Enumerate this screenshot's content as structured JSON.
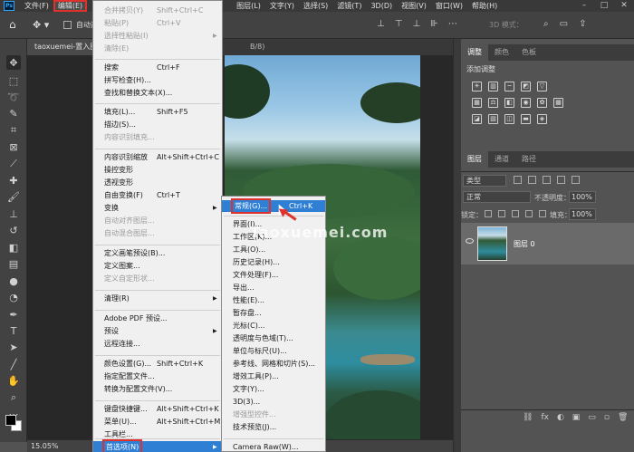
{
  "menubar": {
    "logo": "Ps",
    "items": [
      "文件(F)",
      "编辑(E)",
      "图像(I)",
      "图层(L)",
      "文字(Y)",
      "选择(S)",
      "滤镜(T)",
      "3D(D)",
      "视图(V)",
      "窗口(W)",
      "帮助(H)"
    ],
    "window_controls": [
      "–",
      "□",
      "✕"
    ]
  },
  "options": {
    "auto_select_label": "自动选择",
    "mode_3d": "3D 模式："
  },
  "document": {
    "tab_label": "taoxuemei-置入图",
    "tab_tail": "B/8)",
    "zoom": "15.05%",
    "watermark": "Taoxuemei.com"
  },
  "right_panel": {
    "top_tabs": [
      "调整",
      "颜色",
      "色板"
    ],
    "add_adjustment": "添加调整",
    "layer_tabs": [
      "图层",
      "通道",
      "路径"
    ],
    "filter_kind": "类型",
    "blend_mode": "正常",
    "opacity_label": "不透明度：",
    "opacity_value": "100%",
    "lock_label": "锁定：",
    "fill_label": "填充：",
    "fill_value": "100%",
    "layer_name": "图层 0",
    "footer_icons": [
      "fx",
      "◐",
      "▣",
      "▭",
      "▫",
      "🗑"
    ]
  },
  "edit_menu": {
    "items": [
      {
        "label": "合并拷贝(Y)",
        "shortcut": "Shift+Ctrl+C",
        "disabled": true
      },
      {
        "label": "粘贴(P)",
        "shortcut": "Ctrl+V",
        "disabled": true
      },
      {
        "label": "选择性粘贴(I)",
        "shortcut": "",
        "disabled": true,
        "submenu": true
      },
      {
        "label": "清除(E)",
        "shortcut": "",
        "disabled": true
      },
      {
        "label": "搜索",
        "shortcut": "Ctrl+F"
      },
      {
        "label": "拼写检查(H)...",
        "shortcut": ""
      },
      {
        "label": "查找和替换文本(X)...",
        "shortcut": ""
      },
      {
        "label": "填充(L)...",
        "shortcut": "Shift+F5"
      },
      {
        "label": "描边(S)...",
        "shortcut": ""
      },
      {
        "label": "内容识别填充...",
        "shortcut": "",
        "disabled": true
      },
      {
        "label": "内容识别缩放",
        "shortcut": "Alt+Shift+Ctrl+C"
      },
      {
        "label": "操控变形",
        "shortcut": ""
      },
      {
        "label": "透视变形",
        "shortcut": ""
      },
      {
        "label": "自由变换(F)",
        "shortcut": "Ctrl+T"
      },
      {
        "label": "变换",
        "shortcut": "",
        "submenu": true
      },
      {
        "label": "自动对齐图层...",
        "shortcut": "",
        "disabled": true
      },
      {
        "label": "自动混合图层...",
        "shortcut": "",
        "disabled": true
      },
      {
        "label": "定义画笔预设(B)...",
        "shortcut": ""
      },
      {
        "label": "定义图案...",
        "shortcut": ""
      },
      {
        "label": "定义自定形状...",
        "shortcut": "",
        "disabled": true
      },
      {
        "label": "清理(R)",
        "shortcut": "",
        "submenu": true
      },
      {
        "label": "Adobe PDF 预设...",
        "shortcut": ""
      },
      {
        "label": "预设",
        "shortcut": "",
        "submenu": true
      },
      {
        "label": "远程连接...",
        "shortcut": ""
      },
      {
        "label": "颜色设置(G)...",
        "shortcut": "Shift+Ctrl+K"
      },
      {
        "label": "指定配置文件...",
        "shortcut": ""
      },
      {
        "label": "转换为配置文件(V)...",
        "shortcut": ""
      },
      {
        "label": "键盘快捷键...",
        "shortcut": "Alt+Shift+Ctrl+K"
      },
      {
        "label": "菜单(U)...",
        "shortcut": "Alt+Shift+Ctrl+M"
      },
      {
        "label": "工具栏...",
        "shortcut": ""
      },
      {
        "label": "首选项(N)",
        "shortcut": "",
        "submenu": true,
        "highlighted": true
      }
    ]
  },
  "prefs_menu": {
    "items": [
      {
        "label": "常规(G)...",
        "shortcut": "Ctrl+K",
        "highlighted": true
      },
      {
        "label": "界面(I)...",
        "shortcut": ""
      },
      {
        "label": "工作区(K)...",
        "shortcut": ""
      },
      {
        "label": "工具(O)...",
        "shortcut": ""
      },
      {
        "label": "历史记录(H)...",
        "shortcut": ""
      },
      {
        "label": "文件处理(F)...",
        "shortcut": ""
      },
      {
        "label": "导出...",
        "shortcut": ""
      },
      {
        "label": "性能(E)...",
        "shortcut": ""
      },
      {
        "label": "暂存盘...",
        "shortcut": ""
      },
      {
        "label": "光标(C)...",
        "shortcut": ""
      },
      {
        "label": "透明度与色域(T)...",
        "shortcut": ""
      },
      {
        "label": "单位与标尺(U)...",
        "shortcut": ""
      },
      {
        "label": "参考线、网格和切片(S)...",
        "shortcut": ""
      },
      {
        "label": "增效工具(P)...",
        "shortcut": ""
      },
      {
        "label": "文字(Y)...",
        "shortcut": ""
      },
      {
        "label": "3D(3)...",
        "shortcut": ""
      },
      {
        "label": "增强型控件...",
        "shortcut": "",
        "disabled": true
      },
      {
        "label": "技术预览(J)...",
        "shortcut": ""
      },
      {
        "label": "Camera Raw(W)...",
        "shortcut": ""
      }
    ]
  }
}
